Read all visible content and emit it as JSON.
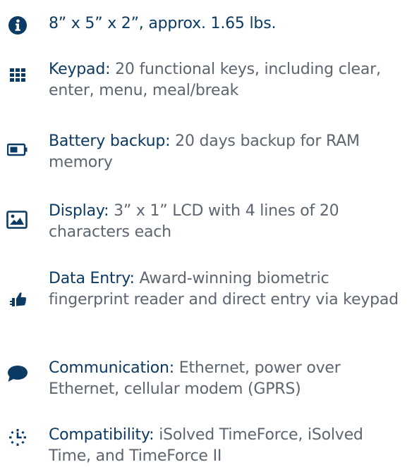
{
  "colors": {
    "accent": "#0b3a64",
    "body_text": "#5c6570"
  },
  "specs": [
    {
      "icon": "info-icon",
      "label": "8” x 5” x 2”, approx. 1.65 lbs.",
      "text": ""
    },
    {
      "icon": "keypad-icon",
      "label": "Keypad:",
      "text": " 20 functional keys, including clear, enter, menu, meal/break"
    },
    {
      "icon": "battery-icon",
      "label": "Battery backup:",
      "text": " 20 days backup for RAM memory"
    },
    {
      "icon": "image-icon",
      "label": "Display:",
      "text": " 3” x 1” LCD with 4 lines of 20 characters each"
    },
    {
      "icon": "thumbs-up-icon",
      "label": "Data Entry:",
      "text": " Award-winning biometric fingerprint reader and direct entry via keypad"
    },
    {
      "icon": "speech-bubble-icon",
      "label": "Communication:",
      "text": " Ethernet, power over Ethernet, cellular modem (GPRS)"
    },
    {
      "icon": "clock-icon",
      "label": "Compatibility:",
      "text": " iSolved TimeForce, iSolved Time, and TimeForce II"
    }
  ]
}
